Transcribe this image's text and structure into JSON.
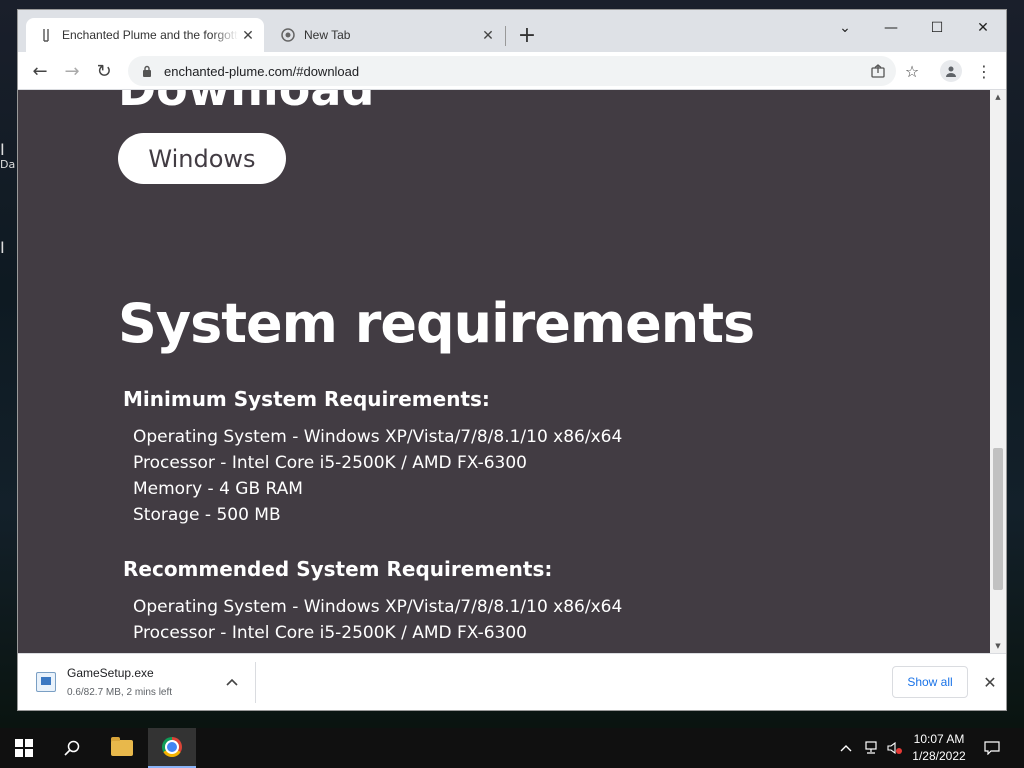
{
  "desktop": {
    "hint_top": "Da"
  },
  "browser": {
    "tabs": [
      {
        "title": "Enchanted Plume and the forgotten",
        "favicon": "plume-favicon-icon",
        "close": "✕"
      },
      {
        "title": "New Tab",
        "favicon": "chrome-favicon-icon",
        "close": "✕"
      }
    ],
    "new_tab_label": "+",
    "window_controls": {
      "tab_search": "⌄",
      "minimize": "—",
      "maximize": "☐",
      "close": "✕"
    },
    "nav": {
      "back": "←",
      "forward": "→",
      "reload": "↻"
    },
    "address": {
      "url": "enchanted-plume.com/#download"
    }
  },
  "page": {
    "download_heading": "Download",
    "windows_button": "Windows",
    "sysreq_heading": "System requirements",
    "minimum": {
      "title": "Minimum System Requirements:",
      "items": [
        "Operating System - Windows XP/Vista/7/8/8.1/10 x86/x64",
        "Processor - Intel Core i5-2500K / AMD FX-6300",
        "Memory - 4 GB RAM",
        "Storage - 500 MB"
      ]
    },
    "recommended": {
      "title": "Recommended System Requirements:",
      "items": [
        "Operating System - Windows XP/Vista/7/8/8.1/10 x86/x64",
        "Processor - Intel Core i5-2500K / AMD FX-6300"
      ]
    },
    "colors": {
      "background": "#423c43",
      "text": "#ffffff"
    }
  },
  "download_bar": {
    "filename": "GameSetup.exe",
    "status": "0.6/82.7 MB, 2 mins left",
    "show_all": "Show all"
  },
  "taskbar": {
    "clock_time": "10:07 AM",
    "clock_date": "1/28/2022"
  }
}
